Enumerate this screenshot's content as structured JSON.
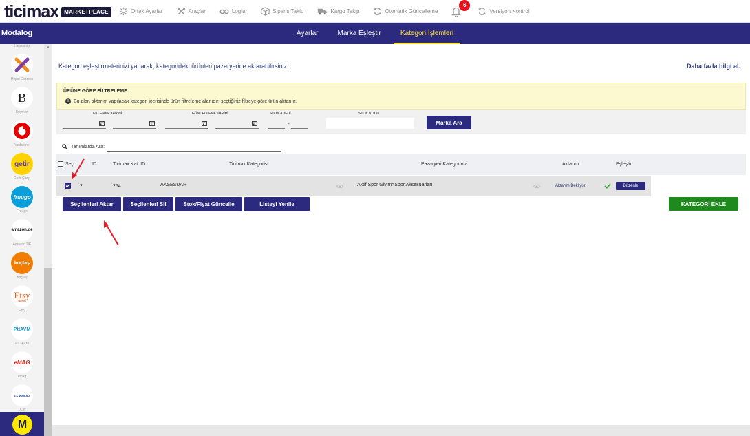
{
  "app": {
    "logo_text": "ticimax",
    "logo_badge": "MARKETPLACE"
  },
  "topnav": [
    {
      "label": "Ortak Ayarlar",
      "icon": "gear-icon"
    },
    {
      "label": "Araçlar",
      "icon": "tools-icon"
    },
    {
      "label": "Loglar",
      "icon": "log-icon"
    },
    {
      "label": "Sipariş Takip",
      "icon": "box-icon"
    },
    {
      "label": "Kargo Takip",
      "icon": "truck-icon"
    },
    {
      "label": "Otomatik Güncelleme",
      "icon": "sync-icon"
    },
    {
      "label": "Versiyon Kontrol",
      "icon": "sync-icon"
    }
  ],
  "notifications": {
    "count": "6",
    "icon": "bell-icon"
  },
  "navbar": {
    "brand": "Modalog",
    "tabs": [
      "Ayarlar",
      "Marka Eşleştir",
      "Kategori İşlemleri"
    ],
    "active_tab": "Kategori İşlemleri"
  },
  "sidebar": {
    "cut_label": "Hepsiship",
    "items": [
      {
        "label": "Hepsi Express",
        "icon": "hepsi-express-logo",
        "mark": "X"
      },
      {
        "label": "Beymen",
        "icon": "beymen-logo",
        "mark": "B"
      },
      {
        "label": "Vodafone",
        "icon": "vodafone-logo",
        "mark": ""
      },
      {
        "label": "Getir Çarşı",
        "icon": "getir-logo",
        "mark": "getir"
      },
      {
        "label": "Fruugo",
        "icon": "fruugo-logo",
        "mark": "fruugo"
      },
      {
        "label": "Amazon DE",
        "icon": "amazon-logo",
        "mark": "amazon.de"
      },
      {
        "label": "Koçtaş",
        "icon": "koctas-logo",
        "mark": "koçtaş"
      },
      {
        "label": "Etsy",
        "icon": "etsy-logo",
        "mark": "Etsy"
      },
      {
        "label": "PTTAVM",
        "icon": "pttavm-logo",
        "mark": "PttAVM"
      },
      {
        "label": "emag",
        "icon": "emag-logo",
        "mark": "eMAG"
      },
      {
        "label": "LCW",
        "icon": "lcw-logo",
        "mark": "LC WAIKIKI"
      }
    ],
    "etsy_sub": "Berlin",
    "active_mark": "M"
  },
  "main": {
    "intro": "Kategori eşleştirmelerinizi yaparak, kategorideki ürünleri pazaryerine aktarabilirsiniz.",
    "more_info": "Daha fazla bilgi al."
  },
  "filter": {
    "title": "ÜRÜNE GÖRE FİLTRELEME",
    "note": "Bu alan aktarım yapılacak kategori içerisinde ürün filtreleme alanıdır, seçtiğiniz filtreye göre ürün aktarılır.",
    "labels": {
      "created": "EKLENME TARİHİ",
      "updated": "GÜNCELLEME TARİHİ",
      "stock_count": "STOK ADEDİ",
      "stock_code": "STOK KODU"
    },
    "range_dash": "-",
    "search_button": "Marka Ara"
  },
  "search": {
    "label": "Tanımlarda Ara:",
    "value": ""
  },
  "table": {
    "headers": {
      "select": "Seç",
      "id": "ID",
      "ticimax_id": "Ticimax Kat. ID",
      "ticimax_cat": "Ticimax Kategorisi",
      "market_cat": "Pazaryeri Kategoriniz",
      "transfer": "Aktarım",
      "match": "Eşleştir"
    },
    "rows": [
      {
        "selected": true,
        "id": "2",
        "ticimax_id": "254",
        "ticimax_cat": "AKSESUAR",
        "market_cat": "Aktif Spor Giyim>Spor Aksesuarları",
        "transfer": "Aktarım Bekliyor",
        "edit": "Düzenle"
      }
    ]
  },
  "actions": {
    "transfer_selected": "Seçilenleri Aktar",
    "delete_selected": "Seçilenleri Sil",
    "update_stock_price": "Stok/Fiyat Güncelle",
    "refresh_list": "Listeyi Yenile",
    "add_category": "KATEGORİ EKLE"
  },
  "colors": {
    "primary": "#2b2a7e",
    "accent": "#ffe12e",
    "filter_bg": "#fcf8d0",
    "success": "#1e8a1e",
    "badge": "#e8101a",
    "annotation": "#e0202a"
  }
}
